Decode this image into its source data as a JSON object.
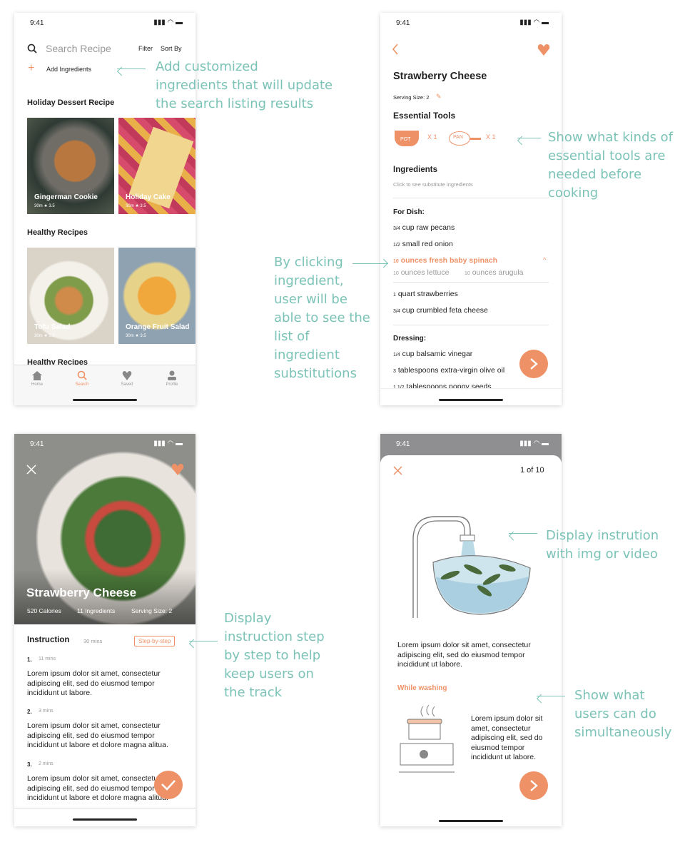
{
  "status_time": "9:41",
  "screen1": {
    "search_placeholder": "Search Recipe",
    "filter": "Filter",
    "sort": "Sort By",
    "add_ingredients": "Add Ingredients",
    "section1": "Holiday Dessert Recipe",
    "card1_title": "Gingerman Cookie",
    "card1_meta": "30m  ★ 3.5",
    "card2_title": "Holiday Cake",
    "card2_meta": "30m  ★ 3.5",
    "section2": "Healthy Recipes",
    "card3_title": "Tofu Salad",
    "card3_meta": "30m  ★ 3.5",
    "card4_title": "Orange Fruit Salad",
    "card4_meta": "30m  ★ 3.5",
    "section3": "Healthy Recipes",
    "tabs": [
      "Home",
      "Search",
      "Saved",
      "Profile"
    ]
  },
  "screen2": {
    "title": "Strawberry Cheese",
    "serving": "Serving Size: 2",
    "tools_h": "Essential Tools",
    "pot": "POT",
    "pot_qty": "X 1",
    "pan": "PAN",
    "pan_qty": "X 1",
    "ing_h": "Ingredients",
    "ing_hint": "Click to see substitute ingredients",
    "for_dish": "For Dish:",
    "i1_q": "3/4",
    "i1": "cup raw pecans",
    "i2_q": "1/2",
    "i2": "small red onion",
    "i3_q": "10",
    "i3": "ounces fresh baby spinach",
    "sub1_q": "10",
    "sub1": "ounces lettuce",
    "sub2_q": "10",
    "sub2": "ounces arugula",
    "i4_q": "1",
    "i4": "quart strawberries",
    "i5_q": "3/4",
    "i5": "cup crumbled feta cheese",
    "dressing": "Dressing:",
    "d1_q": "1/4",
    "d1": "cup balsamic vinegar",
    "d2_q": "3",
    "d2": "tablespoons extra-virgin olive oil",
    "d3_q": "1 1/2",
    "d3": "tablespoons poppy seeds"
  },
  "screen3": {
    "title": "Strawberry Cheese",
    "calories": "520 Calories",
    "ingredients": "11 Ingredients",
    "serving": "Serving Size: 2",
    "instr_h": "Instruction",
    "instr_time": "30 mins",
    "step_btn": "Step-by-step",
    "s1_n": "1.",
    "s1_t": "11 mins",
    "s1": "Lorem ipsum dolor sit amet, consectetur adipiscing elit, sed do eiusmod tempor incididunt ut labore.",
    "s2_n": "2.",
    "s2_t": "3 mins",
    "s2": "Lorem ipsum dolor sit amet, consectetur adipiscing elit, sed do eiusmod tempor incididunt ut labore et dolore magna alitua.",
    "s3_n": "3.",
    "s3_t": "2 mins",
    "s3": "Lorem ipsum dolor sit amet, consectetur adipiscing elit, sed do eiusmod tempor incididunt ut labore et dolore magna alitua."
  },
  "screen4": {
    "pager": "1 of 10",
    "text": "Lorem ipsum dolor sit amet, consectetur adipiscing elit, sed do eiusmod tempor incididunt ut labore.",
    "while": "While washing",
    "side_text": "Lorem ipsum dolor sit amet, consectetur adipiscing elit, sed do eiusmod tempor incididunt ut labore."
  },
  "annotations": {
    "a1": "Add customized ingredients that will update the search listing results",
    "a2": "Show what kinds of essential tools are needed before cooking",
    "a3": "By clicking ingredient, user will be able to see the list of ingredient substitutions",
    "a4": "Display instruction step by step to help keep users on the track",
    "a5": "Display instrution with img or video",
    "a6": "Show what users can do simultaneously"
  },
  "colors": {
    "accent": "#EE9166",
    "annotation": "#7CC3B7"
  }
}
